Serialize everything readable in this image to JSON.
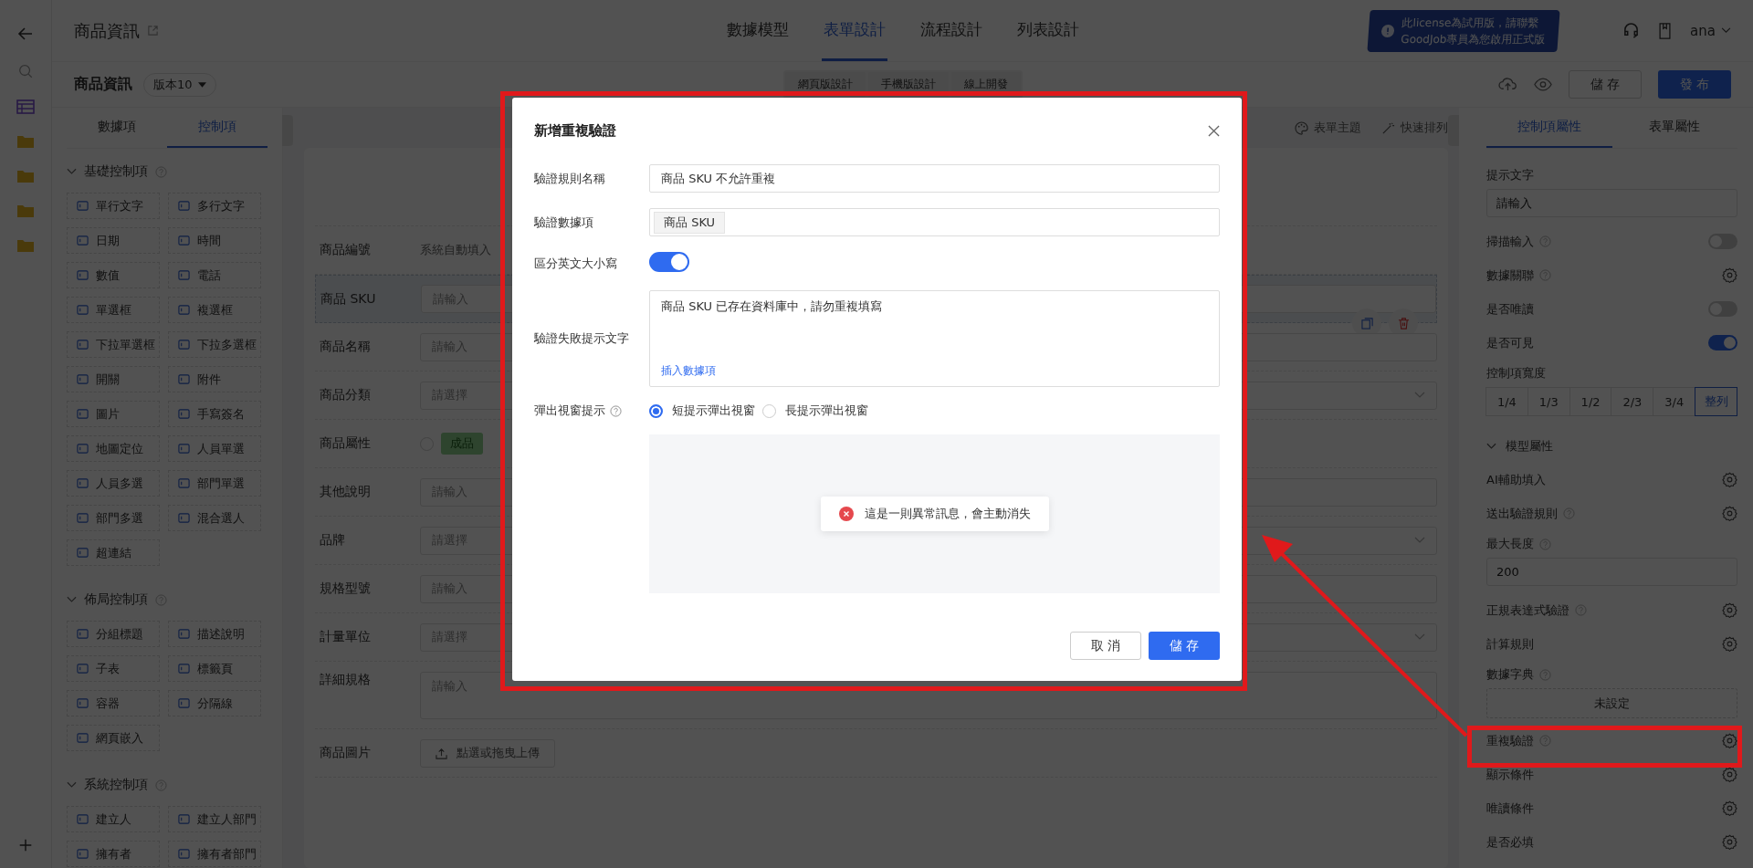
{
  "header": {
    "title": "商品資訊",
    "nav_tabs": [
      {
        "label": "數據模型",
        "selected": false
      },
      {
        "label": "表單設計",
        "selected": true
      },
      {
        "label": "流程設計",
        "selected": false
      },
      {
        "label": "列表設計",
        "selected": false
      }
    ],
    "license_notice": [
      "此license為試用版，請聯繫",
      "GoodJob專員為您啟用正式版"
    ],
    "user": "ana"
  },
  "toolbar": {
    "form_name": "商品資訊",
    "version": "版本10",
    "design_modes": [
      "網頁版設計",
      "手機版設計",
      "線上開發"
    ],
    "save": "儲 存",
    "publish": "發 布"
  },
  "left_panel": {
    "tabs": [
      {
        "label": "數據項",
        "selected": false
      },
      {
        "label": "控制項",
        "selected": true
      }
    ],
    "groups": [
      {
        "title": "基礎控制項",
        "expanded": true,
        "items": [
          "單行文字",
          "多行文字",
          "日期",
          "時間",
          "數值",
          "電話",
          "單選框",
          "複選框",
          "下拉單選框",
          "下拉多選框",
          "開關",
          "附件",
          "圖片",
          "手寫簽名",
          "地圖定位",
          "人員單選",
          "人員多選",
          "部門單選",
          "部門多選",
          "混合選人",
          "超連結"
        ]
      },
      {
        "title": "佈局控制項",
        "expanded": true,
        "items": [
          "分組標題",
          "描述說明",
          "子表",
          "標籤頁",
          "容器",
          "分隔線",
          "網頁嵌入"
        ]
      },
      {
        "title": "系統控制項",
        "expanded": true,
        "items": [
          "建立人",
          "建立人部門",
          "擁有者",
          "擁有者部門"
        ]
      }
    ]
  },
  "canvas": {
    "tools": [
      "表單主題",
      "快速排列"
    ],
    "fields": [
      {
        "label": "商品編號",
        "kind": "auto",
        "text": "系統自動填入",
        "selected": false
      },
      {
        "label": "商品 SKU",
        "kind": "input",
        "placeholder": "請輸入",
        "selected": true
      },
      {
        "label": "商品名稱",
        "kind": "input",
        "placeholder": "請輸入",
        "selected": false
      },
      {
        "label": "商品分類",
        "kind": "select",
        "placeholder": "請選擇",
        "selected": false
      },
      {
        "label": "商品屬性",
        "kind": "radio",
        "options": [
          "成品"
        ],
        "selected": false
      },
      {
        "label": "其他說明",
        "kind": "input",
        "placeholder": "請輸入",
        "selected": false
      },
      {
        "label": "品牌",
        "kind": "select",
        "placeholder": "請選擇",
        "selected": false
      },
      {
        "label": "規格型號",
        "kind": "input",
        "placeholder": "請輸入",
        "selected": false
      },
      {
        "label": "計量單位",
        "kind": "select",
        "placeholder": "請選擇",
        "selected": false
      },
      {
        "label": "詳細規格",
        "kind": "textarea",
        "placeholder": "請輸入",
        "selected": false
      },
      {
        "label": "商品圖片",
        "kind": "upload",
        "text": "點選或拖曳上傳",
        "selected": false
      }
    ]
  },
  "properties": {
    "tabs": [
      {
        "label": "控制項屬性",
        "selected": true
      },
      {
        "label": "表單屬性",
        "selected": false
      }
    ],
    "rows": [
      {
        "kind": "input",
        "label": "提示文字",
        "help": false,
        "value": "請輸入"
      },
      {
        "kind": "toggle",
        "label": "掃描輸入",
        "help": true,
        "on": false
      },
      {
        "kind": "gear",
        "label": "數據關聯",
        "help": true
      },
      {
        "kind": "toggle",
        "label": "是否唯讀",
        "help": false,
        "on": false
      },
      {
        "kind": "toggle",
        "label": "是否可見",
        "help": false,
        "on": true
      },
      {
        "kind": "segmented",
        "label": "控制項寬度",
        "help": false,
        "options": [
          {
            "label": "1/4",
            "selected": false
          },
          {
            "label": "1/3",
            "selected": false
          },
          {
            "label": "1/2",
            "selected": false
          },
          {
            "label": "2/3",
            "selected": false
          },
          {
            "label": "3/4",
            "selected": false
          },
          {
            "label": "整列",
            "selected": true
          }
        ]
      },
      {
        "kind": "section",
        "label": "模型屬性",
        "expanded": true
      },
      {
        "kind": "gear",
        "label": "AI輔助填入",
        "help": false
      },
      {
        "kind": "gear",
        "label": "送出驗證規則",
        "help": true
      },
      {
        "kind": "input",
        "label": "最大長度",
        "help": true,
        "value": "200"
      },
      {
        "kind": "gear",
        "label": "正規表達式驗證",
        "help": true
      },
      {
        "kind": "gear",
        "label": "計算規則",
        "help": false
      },
      {
        "kind": "dashed",
        "label": "數據字典",
        "help": true,
        "value": "未設定"
      },
      {
        "kind": "gear",
        "label": "重複驗證",
        "help": true
      },
      {
        "kind": "gear",
        "label": "顯示條件",
        "help": false
      },
      {
        "kind": "gear",
        "label": "唯讀條件",
        "help": false
      },
      {
        "kind": "gear",
        "label": "是否必填",
        "help": false
      }
    ]
  },
  "dialog": {
    "title": "新增重複驗證",
    "rule_name": {
      "label": "驗證規則名稱",
      "value": "商品 SKU 不允許重複"
    },
    "field": {
      "label": "驗證數據項",
      "tags": [
        "商品 SKU"
      ]
    },
    "case_sensitive": {
      "label": "區分英文大小寫",
      "on": true
    },
    "fail_message": {
      "label": "驗證失敗提示文字",
      "value": "商品 SKU 已存在資料庫中，請勿重複填寫",
      "insert_link": "插入數據項"
    },
    "popup": {
      "label": "彈出視窗提示",
      "help": true,
      "options": [
        {
          "label": "短提示彈出視窗",
          "selected": true
        },
        {
          "label": "長提示彈出視窗",
          "selected": false
        }
      ],
      "preview_message": "這是一則異常訊息，會主動消失"
    },
    "cancel": "取 消",
    "save": "儲 存"
  }
}
